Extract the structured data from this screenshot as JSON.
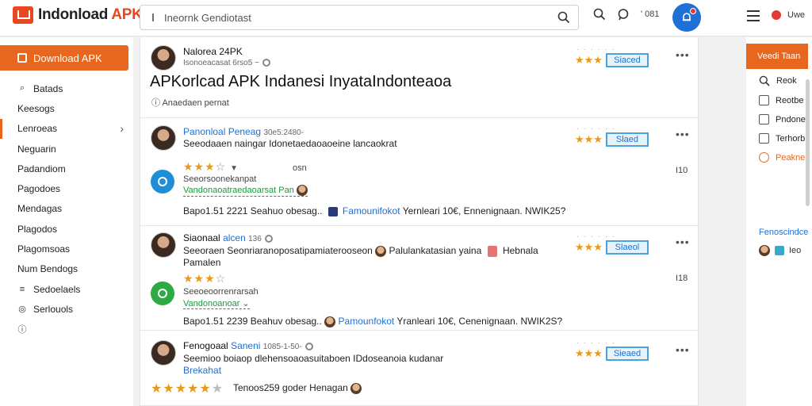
{
  "header": {
    "logo_text": "Indonload",
    "logo_accent": "APK",
    "search_placeholder": "Ineornk Gendiotast",
    "count": "' 081",
    "user_label": "Uwe"
  },
  "sidebar": {
    "download_label": "Download APK",
    "items": [
      {
        "label": "Batads",
        "icon": "search-icon"
      },
      {
        "label": "Keesogs",
        "icon": ""
      },
      {
        "label": "Lenroeas",
        "icon": ""
      },
      {
        "label": "Neguarin",
        "icon": ""
      },
      {
        "label": "Padandiom",
        "icon": ""
      },
      {
        "label": "Pagodoes",
        "icon": ""
      },
      {
        "label": "Mendagas",
        "icon": ""
      },
      {
        "label": "Plagodos",
        "icon": ""
      },
      {
        "label": "Plagomsoas",
        "icon": ""
      },
      {
        "label": "Num Bendogs",
        "icon": ""
      },
      {
        "label": "Sedoelaels",
        "icon": "list-icon"
      },
      {
        "label": "Serlouols",
        "icon": "settings-icon"
      }
    ]
  },
  "feed": {
    "post1": {
      "author": "Nalorea 24PK",
      "meta": "Isonoeacasat 6rso5 ~",
      "title": "APKorlcad APK Indanesi InyataIndonteaoa",
      "sub": "Anaedaen pernat",
      "rating_label": "Siaced"
    },
    "post2": {
      "author": "Panonloal Peneag",
      "meta": "30e5:2480-",
      "body": "Seeodaaen naingar Idonetaedaoaoeine lancaokrat",
      "section_tiny": "osn",
      "num_right": "I10",
      "green_link": "Vandonaoatraedaoarsat Pan",
      "footer_date": "Bapo1.51 2221",
      "footer_text": "Seahuo obesag..",
      "footer_link": "Famounifokot",
      "footer_tail": "Yernleari 10€, Ennenignaan. NWIK25?",
      "rating_label": "Slaed",
      "icon_color": "#1e8fd6"
    },
    "post3": {
      "author": "Siaonaal",
      "author_blue": "alcen",
      "meta": "136",
      "body1": "Seeoraen Seonriaranoposatipamiaterooseon",
      "body1_tail": "Palulankatasian yaina",
      "body1_end": "Hebnala",
      "body2": "Pamalen",
      "sub": "Seeoeoorrenrarsah",
      "num_right": "I18",
      "green_link": "Vandonoanoar",
      "footer_date": "Bapo1.51 2239",
      "footer_text": "Beahuv obesag..",
      "footer_link": "Pamounfokot",
      "footer_tail": "Yranleari 10€, Cenenignaan. NWIK2S?",
      "rating_label": "Slaeol",
      "icon_color": "#2eaa45"
    },
    "post4": {
      "author": "Fenogoaal",
      "author_blue": "Saneni",
      "meta": "1085-1-50-",
      "body1": "Seemioo boiaop dlehensoaoasuitaboen IDdoseanoia kudanar",
      "body2": "Brekahat",
      "footer_text": "Tenoos259 goder Henagan",
      "rating_label": "Sieaed"
    }
  },
  "right_panel": {
    "head": "Veedi Taan",
    "items": [
      {
        "label": "Reok"
      },
      {
        "label": "Reotbe"
      },
      {
        "label": "Pndone"
      },
      {
        "label": "Terhorb"
      },
      {
        "label": "Peakne"
      }
    ],
    "link": "Fenoscindce",
    "users_label": "Ieo"
  }
}
